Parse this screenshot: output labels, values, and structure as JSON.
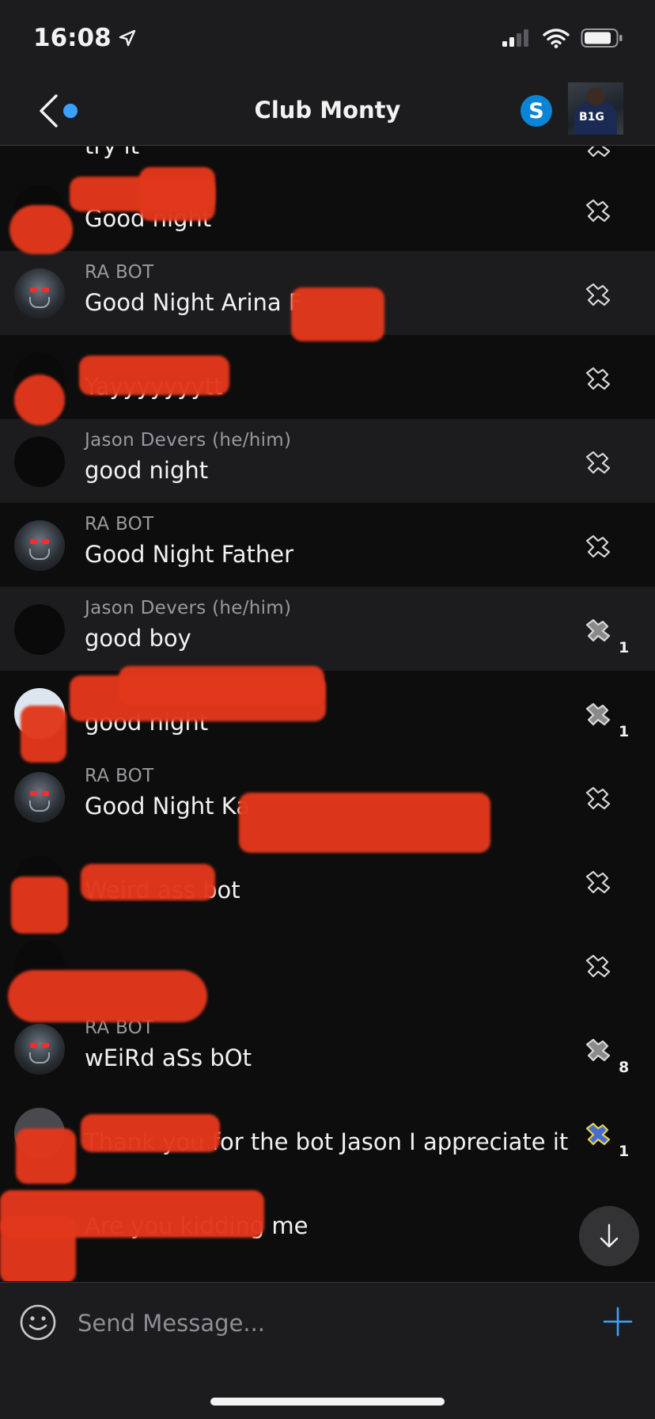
{
  "status_bar": {
    "time": "16:08"
  },
  "header": {
    "title": "Club Monty"
  },
  "messages": [
    {
      "sender": "",
      "text": "try it",
      "reaction_count": ""
    },
    {
      "sender": "",
      "text": "Good night",
      "reaction_count": ""
    },
    {
      "sender": "RA BOT",
      "text": "Good Night Arina F",
      "reaction_count": ""
    },
    {
      "sender": "",
      "text": "Yayyyyyyytt",
      "reaction_count": ""
    },
    {
      "sender": "Jason Devers (he/him)",
      "text": "good night",
      "reaction_count": ""
    },
    {
      "sender": "RA BOT",
      "text": "Good Night Father",
      "reaction_count": ""
    },
    {
      "sender": "Jason Devers (he/him)",
      "text": "good boy",
      "reaction_count": "1"
    },
    {
      "sender": "",
      "text": "good night",
      "reaction_count": "1"
    },
    {
      "sender": "RA BOT",
      "text": "Good Night Ka",
      "reaction_count": ""
    },
    {
      "sender": "",
      "text": "Weird ass bot",
      "reaction_count": ""
    },
    {
      "sender": "",
      "text": "",
      "reaction_count": ""
    },
    {
      "sender": "RA BOT",
      "text": "wEiRd aSs bOt",
      "reaction_count": "8"
    },
    {
      "sender": "",
      "text": "Thank you for the bot Jason I appreciate it",
      "reaction_count": "1"
    },
    {
      "sender": "",
      "text": "Are you kidding me",
      "reaction_count": ""
    }
  ],
  "composer": {
    "placeholder": "Send Message..."
  },
  "colors": {
    "accent": "#3aa1ff",
    "redaction": "#e2381c",
    "background": "#0d0d0d",
    "surface": "#1c1c1e"
  },
  "icons": {
    "back": "chevron-left-icon",
    "skype": "skype-icon",
    "reaction": "reaction-icon",
    "scroll_down": "arrow-down-icon",
    "emoji": "emoji-icon",
    "add": "plus-icon"
  }
}
